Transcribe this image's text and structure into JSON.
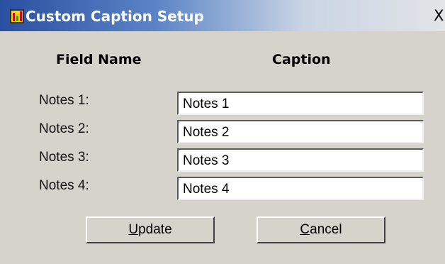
{
  "window": {
    "title": "Custom Caption Setup",
    "close_glyph": "X"
  },
  "headers": {
    "field_name": "Field Name",
    "caption": "Caption"
  },
  "fields": [
    {
      "label": "Notes 1:",
      "value": "Notes 1"
    },
    {
      "label": "Notes 2:",
      "value": "Notes 2"
    },
    {
      "label": "Notes 3:",
      "value": "Notes 3"
    },
    {
      "label": "Notes 4:",
      "value": "Notes 4"
    }
  ],
  "buttons": {
    "update": {
      "mnemonic": "U",
      "rest": "pdate"
    },
    "cancel": {
      "mnemonic": "C",
      "rest": "ancel"
    }
  },
  "colors": {
    "titlebar_start": "#2a4fa0",
    "titlebar_end": "#e2e4e6",
    "window_bg": "#d6d2cc"
  },
  "icons": {
    "app": "bar-chart-icon",
    "close": "close-icon"
  }
}
